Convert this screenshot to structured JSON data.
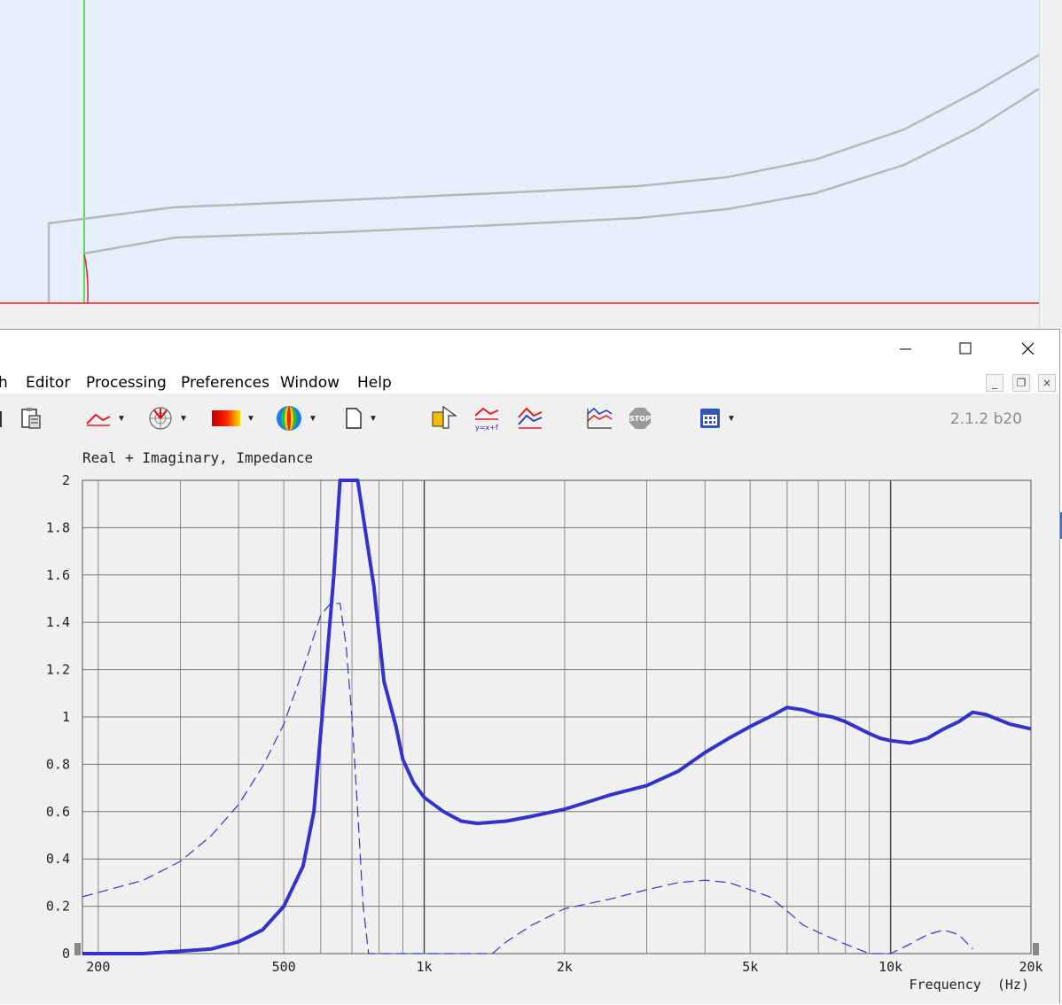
{
  "menu": {
    "items": [
      "h",
      "Editor",
      "Processing",
      "Preferences",
      "Window",
      "Help"
    ]
  },
  "window_controls": {
    "minimize_glyph": "—",
    "maximize_glyph": "☐",
    "close_glyph": "✕"
  },
  "mdi_controls": {
    "minimize": "_",
    "restore": "❐",
    "close": "×"
  },
  "toolbar": {
    "version": "2.1.2 b20",
    "icons": [
      "clipboard-icon",
      "frequency-response-icon",
      "polar-plot-icon",
      "color-map-icon",
      "balloon-3d-icon",
      "new-document-icon",
      "export-3d-icon",
      "formula-curve-icon",
      "multi-curve-icon",
      "average-curve-icon",
      "stop-icon",
      "calculator-icon"
    ]
  },
  "colors": {
    "top_bg": "#e6f0fc",
    "guide_green": "#55e055",
    "axis_red": "#ee2222",
    "profile_gray": "#b8b8b8",
    "curve_blue": "#3333cc",
    "chart_bg": "#f0f0f0",
    "grid": "#777777"
  },
  "chart_data": {
    "type": "line",
    "title": "Real + Imaginary, Impedance",
    "xlabel": "Frequency  (Hz)",
    "ylabel": "",
    "xscale": "log",
    "xlim": [
      185,
      20000
    ],
    "ylim": [
      0,
      2
    ],
    "x_ticks": [
      200,
      500,
      1000,
      2000,
      5000,
      10000,
      20000
    ],
    "x_tick_labels": [
      "200",
      "500",
      "1k",
      "2k",
      "5k",
      "10k",
      "20k"
    ],
    "y_ticks": [
      0,
      0.2,
      0.4,
      0.6,
      0.8,
      1,
      1.2,
      1.4,
      1.6,
      1.8,
      2
    ],
    "y_tick_labels": [
      "0",
      "0.2",
      "0.4",
      "0.6",
      "0.8",
      "1",
      "1.2",
      "1.4",
      "1.6",
      "1.8",
      "2"
    ],
    "series": [
      {
        "style": "solid",
        "x": [
          185,
          250,
          300,
          350,
          400,
          450,
          500,
          550,
          580,
          610,
          640,
          660,
          690,
          720,
          780,
          820,
          870,
          900,
          950,
          1000,
          1100,
          1200,
          1300,
          1500,
          1700,
          2000,
          2500,
          3000,
          3500,
          4000,
          4500,
          5000,
          5500,
          6000,
          6500,
          7000,
          7500,
          8000,
          9000,
          9500,
          10000,
          11000,
          12000,
          13000,
          14000,
          15000,
          16000,
          17000,
          18000,
          20000
        ],
        "y": [
          0,
          0,
          0.01,
          0.02,
          0.05,
          0.1,
          0.2,
          0.37,
          0.6,
          1.1,
          1.6,
          2.0,
          2.0,
          2.0,
          1.55,
          1.15,
          0.96,
          0.82,
          0.72,
          0.66,
          0.6,
          0.56,
          0.55,
          0.56,
          0.58,
          0.61,
          0.67,
          0.71,
          0.77,
          0.85,
          0.91,
          0.96,
          1.0,
          1.04,
          1.03,
          1.01,
          1.0,
          0.98,
          0.93,
          0.91,
          0.9,
          0.89,
          0.91,
          0.95,
          0.98,
          1.02,
          1.01,
          0.99,
          0.97,
          0.95
        ]
      },
      {
        "style": "dashed",
        "x": [
          185,
          250,
          300,
          350,
          400,
          450,
          500,
          550,
          600,
          630,
          660,
          680,
          700,
          720,
          740,
          760,
          800,
          1000,
          1200,
          1400,
          1500,
          1700,
          2000,
          2500,
          3000,
          3500,
          4000,
          4500,
          5000,
          5500,
          6000,
          6500,
          7000,
          8000,
          9000,
          10000,
          11000,
          12000,
          13000,
          14000,
          15000
        ],
        "y": [
          0.24,
          0.31,
          0.39,
          0.5,
          0.63,
          0.79,
          0.97,
          1.2,
          1.43,
          1.48,
          1.48,
          1.3,
          1.0,
          0.6,
          0.2,
          0.0,
          0.0,
          0.0,
          0.0,
          0.0,
          0.05,
          0.12,
          0.19,
          0.23,
          0.27,
          0.3,
          0.31,
          0.3,
          0.27,
          0.24,
          0.18,
          0.12,
          0.09,
          0.04,
          0.0,
          0.0,
          0.04,
          0.08,
          0.1,
          0.08,
          0.02
        ]
      }
    ]
  }
}
